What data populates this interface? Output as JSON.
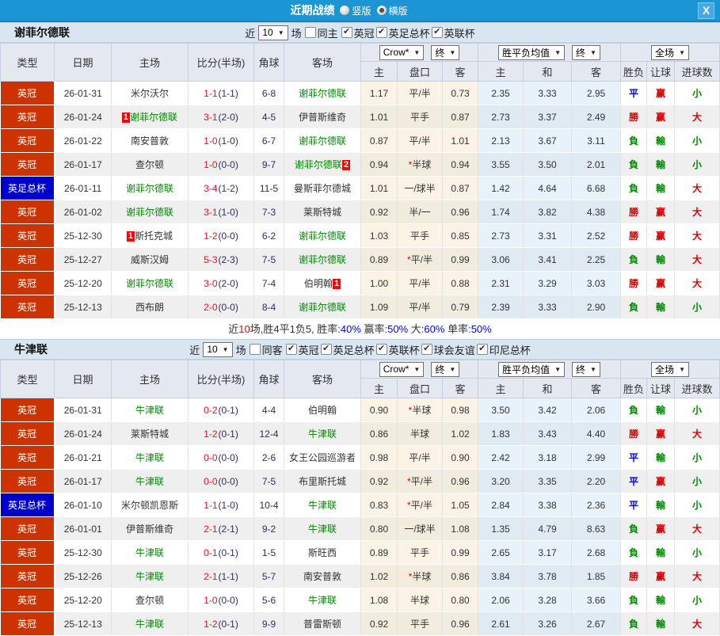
{
  "titlebar": {
    "title": "近期战绩",
    "vertical_label": "竖版",
    "horizontal_label": "横版",
    "selected_mode": "横版",
    "close_label": "X",
    "bar_color": "#1c95d4"
  },
  "colors": {
    "league_bg": "#cc3300",
    "cup_bg": "#0000cc",
    "score_red": "#e8102e",
    "team_green": "#008800"
  },
  "table_header": {
    "main_cols": [
      "类型",
      "日期",
      "主场",
      "比分(半场)",
      "角球",
      "客场"
    ],
    "odds_select": "Crow*",
    "odds_final_select": "终",
    "avg_select": "胜平负均值",
    "avg_final_select": "终",
    "scope_select": "全场",
    "sub_cols": [
      "主",
      "盘口",
      "客",
      "主",
      "和",
      "客",
      "胜负",
      "让球",
      "进球数"
    ]
  },
  "sections": [
    {
      "team": "谢菲尔德联",
      "filter": {
        "near_label": "近",
        "count": "10",
        "games_label": "场",
        "same_label": "同主",
        "same_checked": false,
        "leagues": [
          {
            "label": "英冠",
            "checked": true
          },
          {
            "label": "英足总杯",
            "checked": true
          },
          {
            "label": "英联杯",
            "checked": true
          }
        ]
      },
      "rows": [
        {
          "type": "英冠",
          "type_bg": "#cc3300",
          "date": "26-01-31",
          "home": "米尔沃尔",
          "home_green": false,
          "home_badge": "",
          "score": "1-1",
          "half": "(1-1)",
          "corner": "6-8",
          "away": "谢菲尔德联",
          "away_green": true,
          "away_badge": "",
          "odds_home": "1.17",
          "handicap": "平/半",
          "handicap_star": false,
          "odds_away": "0.73",
          "avg_home": "2.35",
          "avg_draw": "3.33",
          "avg_away": "2.95",
          "result_wdl": "平",
          "result_wdl_color": "blue",
          "result_handicap": "赢",
          "result_handicap_color": "red",
          "result_goals": "小",
          "result_goals_color": "green"
        },
        {
          "type": "英冠",
          "type_bg": "#cc3300",
          "date": "26-01-24",
          "home": "谢菲尔德联",
          "home_green": true,
          "home_badge": "1",
          "score": "3-1",
          "half": "(2-0)",
          "corner": "4-5",
          "away": "伊普斯维奇",
          "away_green": false,
          "away_badge": "",
          "odds_home": "1.01",
          "handicap": "平手",
          "handicap_star": false,
          "odds_away": "0.87",
          "avg_home": "2.73",
          "avg_draw": "3.37",
          "avg_away": "2.49",
          "result_wdl": "勝",
          "result_wdl_color": "red",
          "result_handicap": "赢",
          "result_handicap_color": "red",
          "result_goals": "大",
          "result_goals_color": "red"
        },
        {
          "type": "英冠",
          "type_bg": "#cc3300",
          "date": "26-01-22",
          "home": "南安普敦",
          "home_green": false,
          "home_badge": "",
          "score": "1-0",
          "half": "(1-0)",
          "corner": "6-7",
          "away": "谢菲尔德联",
          "away_green": true,
          "away_badge": "",
          "odds_home": "0.87",
          "handicap": "平/半",
          "handicap_star": false,
          "odds_away": "1.01",
          "avg_home": "2.13",
          "avg_draw": "3.67",
          "avg_away": "3.11",
          "result_wdl": "負",
          "result_wdl_color": "green",
          "result_handicap": "輸",
          "result_handicap_color": "green",
          "result_goals": "小",
          "result_goals_color": "green"
        },
        {
          "type": "英冠",
          "type_bg": "#cc3300",
          "date": "26-01-17",
          "home": "查尔顿",
          "home_green": false,
          "home_badge": "",
          "score": "1-0",
          "half": "(0-0)",
          "corner": "9-7",
          "away": "谢菲尔德联",
          "away_green": true,
          "away_badge": "2",
          "odds_home": "0.94",
          "handicap": "半球",
          "handicap_star": true,
          "odds_away": "0.94",
          "avg_home": "3.55",
          "avg_draw": "3.50",
          "avg_away": "2.01",
          "result_wdl": "負",
          "result_wdl_color": "green",
          "result_handicap": "輸",
          "result_handicap_color": "green",
          "result_goals": "小",
          "result_goals_color": "green"
        },
        {
          "type": "英足总杯",
          "type_bg": "#0000cc",
          "date": "26-01-11",
          "home": "谢菲尔德联",
          "home_green": true,
          "home_badge": "",
          "score": "3-4",
          "half": "(1-2)",
          "corner": "11-5",
          "away": "曼斯菲尔德城",
          "away_green": false,
          "away_badge": "",
          "odds_home": "1.01",
          "handicap": "一/球半",
          "handicap_star": false,
          "odds_away": "0.87",
          "avg_home": "1.42",
          "avg_draw": "4.64",
          "avg_away": "6.68",
          "result_wdl": "負",
          "result_wdl_color": "green",
          "result_handicap": "輸",
          "result_handicap_color": "green",
          "result_goals": "大",
          "result_goals_color": "red"
        },
        {
          "type": "英冠",
          "type_bg": "#cc3300",
          "date": "26-01-02",
          "home": "谢菲尔德联",
          "home_green": true,
          "home_badge": "",
          "score": "3-1",
          "half": "(1-0)",
          "corner": "7-3",
          "away": "莱斯特城",
          "away_green": false,
          "away_badge": "",
          "odds_home": "0.92",
          "handicap": "半/一",
          "handicap_star": false,
          "odds_away": "0.96",
          "avg_home": "1.74",
          "avg_draw": "3.82",
          "avg_away": "4.38",
          "result_wdl": "勝",
          "result_wdl_color": "red",
          "result_handicap": "赢",
          "result_handicap_color": "red",
          "result_goals": "大",
          "result_goals_color": "red"
        },
        {
          "type": "英冠",
          "type_bg": "#cc3300",
          "date": "25-12-30",
          "home": "斯托克城",
          "home_green": false,
          "home_badge": "1",
          "score": "1-2",
          "half": "(0-0)",
          "corner": "6-2",
          "away": "谢菲尔德联",
          "away_green": true,
          "away_badge": "",
          "odds_home": "1.03",
          "handicap": "平手",
          "handicap_star": false,
          "odds_away": "0.85",
          "avg_home": "2.73",
          "avg_draw": "3.31",
          "avg_away": "2.52",
          "result_wdl": "勝",
          "result_wdl_color": "red",
          "result_handicap": "赢",
          "result_handicap_color": "red",
          "result_goals": "大",
          "result_goals_color": "red"
        },
        {
          "type": "英冠",
          "type_bg": "#cc3300",
          "date": "25-12-27",
          "home": "威斯汉姆",
          "home_green": false,
          "home_badge": "",
          "score": "5-3",
          "half": "(2-3)",
          "corner": "7-5",
          "away": "谢菲尔德联",
          "away_green": true,
          "away_badge": "",
          "odds_home": "0.89",
          "handicap": "平/半",
          "handicap_star": true,
          "odds_away": "0.99",
          "avg_home": "3.06",
          "avg_draw": "3.41",
          "avg_away": "2.25",
          "result_wdl": "負",
          "result_wdl_color": "green",
          "result_handicap": "輸",
          "result_handicap_color": "green",
          "result_goals": "大",
          "result_goals_color": "red"
        },
        {
          "type": "英冠",
          "type_bg": "#cc3300",
          "date": "25-12-20",
          "home": "谢菲尔德联",
          "home_green": true,
          "home_badge": "",
          "score": "3-0",
          "half": "(2-0)",
          "corner": "7-4",
          "away": "伯明翰",
          "away_green": false,
          "away_badge": "1",
          "odds_home": "1.00",
          "handicap": "平/半",
          "handicap_star": false,
          "odds_away": "0.88",
          "avg_home": "2.31",
          "avg_draw": "3.29",
          "avg_away": "3.03",
          "result_wdl": "勝",
          "result_wdl_color": "red",
          "result_handicap": "赢",
          "result_handicap_color": "red",
          "result_goals": "大",
          "result_goals_color": "red"
        },
        {
          "type": "英冠",
          "type_bg": "#cc3300",
          "date": "25-12-13",
          "home": "西布朗",
          "home_green": false,
          "home_badge": "",
          "score": "2-0",
          "half": "(0-0)",
          "corner": "8-4",
          "away": "谢菲尔德联",
          "away_green": true,
          "away_badge": "",
          "odds_home": "1.09",
          "handicap": "平/半",
          "handicap_star": false,
          "odds_away": "0.79",
          "avg_home": "2.39",
          "avg_draw": "3.33",
          "avg_away": "2.90",
          "result_wdl": "負",
          "result_wdl_color": "green",
          "result_handicap": "輸",
          "result_handicap_color": "green",
          "result_goals": "小",
          "result_goals_color": "green"
        }
      ],
      "summary": [
        {
          "text": "近"
        },
        {
          "text": "10",
          "color": "red"
        },
        {
          "text": "场,胜4平1负5, 胜率:"
        },
        {
          "text": "40%",
          "color": "blue"
        },
        {
          "text": " 赢率:"
        },
        {
          "text": "50%",
          "color": "blue"
        },
        {
          "text": " 大:"
        },
        {
          "text": "60%",
          "color": "blue"
        },
        {
          "text": " 单率:"
        },
        {
          "text": "50%",
          "color": "blue"
        }
      ]
    },
    {
      "team": "牛津联",
      "filter": {
        "near_label": "近",
        "count": "10",
        "games_label": "场",
        "same_label": "同客",
        "same_checked": false,
        "leagues": [
          {
            "label": "英冠",
            "checked": true
          },
          {
            "label": "英足总杯",
            "checked": true
          },
          {
            "label": "英联杯",
            "checked": true
          },
          {
            "label": "球会友谊",
            "checked": true
          },
          {
            "label": "印尼总杯",
            "checked": true
          }
        ]
      },
      "rows": [
        {
          "type": "英冠",
          "type_bg": "#cc3300",
          "date": "26-01-31",
          "home": "牛津联",
          "home_green": true,
          "home_badge": "",
          "score": "0-2",
          "half": "(0-1)",
          "corner": "4-4",
          "away": "伯明翰",
          "away_green": false,
          "away_badge": "",
          "odds_home": "0.90",
          "handicap": "半球",
          "handicap_star": true,
          "odds_away": "0.98",
          "avg_home": "3.50",
          "avg_draw": "3.42",
          "avg_away": "2.06",
          "result_wdl": "負",
          "result_wdl_color": "green",
          "result_handicap": "輸",
          "result_handicap_color": "green",
          "result_goals": "小",
          "result_goals_color": "green"
        },
        {
          "type": "英冠",
          "type_bg": "#cc3300",
          "date": "26-01-24",
          "home": "莱斯特城",
          "home_green": false,
          "home_badge": "",
          "score": "1-2",
          "half": "(0-1)",
          "corner": "12-4",
          "away": "牛津联",
          "away_green": true,
          "away_badge": "",
          "odds_home": "0.86",
          "handicap": "半球",
          "handicap_star": false,
          "odds_away": "1.02",
          "avg_home": "1.83",
          "avg_draw": "3.43",
          "avg_away": "4.40",
          "result_wdl": "勝",
          "result_wdl_color": "red",
          "result_handicap": "赢",
          "result_handicap_color": "red",
          "result_goals": "大",
          "result_goals_color": "red"
        },
        {
          "type": "英冠",
          "type_bg": "#cc3300",
          "date": "26-01-21",
          "home": "牛津联",
          "home_green": true,
          "home_badge": "",
          "score": "0-0",
          "half": "(0-0)",
          "corner": "2-6",
          "away": "女王公园巡游者",
          "away_green": false,
          "away_badge": "",
          "odds_home": "0.98",
          "handicap": "平/半",
          "handicap_star": false,
          "odds_away": "0.90",
          "avg_home": "2.42",
          "avg_draw": "3.18",
          "avg_away": "2.99",
          "result_wdl": "平",
          "result_wdl_color": "blue",
          "result_handicap": "輸",
          "result_handicap_color": "green",
          "result_goals": "小",
          "result_goals_color": "green"
        },
        {
          "type": "英冠",
          "type_bg": "#cc3300",
          "date": "26-01-17",
          "home": "牛津联",
          "home_green": true,
          "home_badge": "",
          "score": "0-0",
          "half": "(0-0)",
          "corner": "7-5",
          "away": "布里斯托城",
          "away_green": false,
          "away_badge": "",
          "odds_home": "0.92",
          "handicap": "平/半",
          "handicap_star": true,
          "odds_away": "0.96",
          "avg_home": "3.20",
          "avg_draw": "3.35",
          "avg_away": "2.20",
          "result_wdl": "平",
          "result_wdl_color": "blue",
          "result_handicap": "赢",
          "result_handicap_color": "red",
          "result_goals": "小",
          "result_goals_color": "green"
        },
        {
          "type": "英足总杯",
          "type_bg": "#0000cc",
          "date": "26-01-10",
          "home": "米尔顿凯恩斯",
          "home_green": false,
          "home_badge": "",
          "score": "1-1",
          "half": "(1-0)",
          "corner": "10-4",
          "away": "牛津联",
          "away_green": true,
          "away_badge": "",
          "odds_home": "0.83",
          "handicap": "平/半",
          "handicap_star": true,
          "odds_away": "1.05",
          "avg_home": "2.84",
          "avg_draw": "3.38",
          "avg_away": "2.36",
          "result_wdl": "平",
          "result_wdl_color": "blue",
          "result_handicap": "輸",
          "result_handicap_color": "green",
          "result_goals": "小",
          "result_goals_color": "green"
        },
        {
          "type": "英冠",
          "type_bg": "#cc3300",
          "date": "26-01-01",
          "home": "伊普斯维奇",
          "home_green": false,
          "home_badge": "",
          "score": "2-1",
          "half": "(2-1)",
          "corner": "9-2",
          "away": "牛津联",
          "away_green": true,
          "away_badge": "",
          "odds_home": "0.80",
          "handicap": "一/球半",
          "handicap_star": false,
          "odds_away": "1.08",
          "avg_home": "1.35",
          "avg_draw": "4.79",
          "avg_away": "8.63",
          "result_wdl": "負",
          "result_wdl_color": "green",
          "result_handicap": "赢",
          "result_handicap_color": "red",
          "result_goals": "大",
          "result_goals_color": "red"
        },
        {
          "type": "英冠",
          "type_bg": "#cc3300",
          "date": "25-12-30",
          "home": "牛津联",
          "home_green": true,
          "home_badge": "",
          "score": "0-1",
          "half": "(0-1)",
          "corner": "1-5",
          "away": "斯旺西",
          "away_green": false,
          "away_badge": "",
          "odds_home": "0.89",
          "handicap": "平手",
          "handicap_star": false,
          "odds_away": "0.99",
          "avg_home": "2.65",
          "avg_draw": "3.17",
          "avg_away": "2.68",
          "result_wdl": "負",
          "result_wdl_color": "green",
          "result_handicap": "輸",
          "result_handicap_color": "green",
          "result_goals": "小",
          "result_goals_color": "green"
        },
        {
          "type": "英冠",
          "type_bg": "#cc3300",
          "date": "25-12-26",
          "home": "牛津联",
          "home_green": true,
          "home_badge": "",
          "score": "2-1",
          "half": "(1-1)",
          "corner": "5-7",
          "away": "南安普敦",
          "away_green": false,
          "away_badge": "",
          "odds_home": "1.02",
          "handicap": "半球",
          "handicap_star": true,
          "odds_away": "0.86",
          "avg_home": "3.84",
          "avg_draw": "3.78",
          "avg_away": "1.85",
          "result_wdl": "勝",
          "result_wdl_color": "red",
          "result_handicap": "赢",
          "result_handicap_color": "red",
          "result_goals": "大",
          "result_goals_color": "red"
        },
        {
          "type": "英冠",
          "type_bg": "#cc3300",
          "date": "25-12-20",
          "home": "查尔顿",
          "home_green": false,
          "home_badge": "",
          "score": "1-0",
          "half": "(0-0)",
          "corner": "5-6",
          "away": "牛津联",
          "away_green": true,
          "away_badge": "",
          "odds_home": "1.08",
          "handicap": "半球",
          "handicap_star": false,
          "odds_away": "0.80",
          "avg_home": "2.06",
          "avg_draw": "3.28",
          "avg_away": "3.66",
          "result_wdl": "負",
          "result_wdl_color": "green",
          "result_handicap": "輸",
          "result_handicap_color": "green",
          "result_goals": "小",
          "result_goals_color": "green"
        },
        {
          "type": "英冠",
          "type_bg": "#cc3300",
          "date": "25-12-13",
          "home": "牛津联",
          "home_green": true,
          "home_badge": "",
          "score": "1-2",
          "half": "(0-1)",
          "corner": "9-9",
          "away": "普雷斯顿",
          "away_green": false,
          "away_badge": "",
          "odds_home": "0.92",
          "handicap": "平手",
          "handicap_star": false,
          "odds_away": "0.96",
          "avg_home": "2.61",
          "avg_draw": "3.26",
          "avg_away": "2.67",
          "result_wdl": "負",
          "result_wdl_color": "green",
          "result_handicap": "輸",
          "result_handicap_color": "green",
          "result_goals": "大",
          "result_goals_color": "red"
        }
      ],
      "summary": []
    }
  ]
}
